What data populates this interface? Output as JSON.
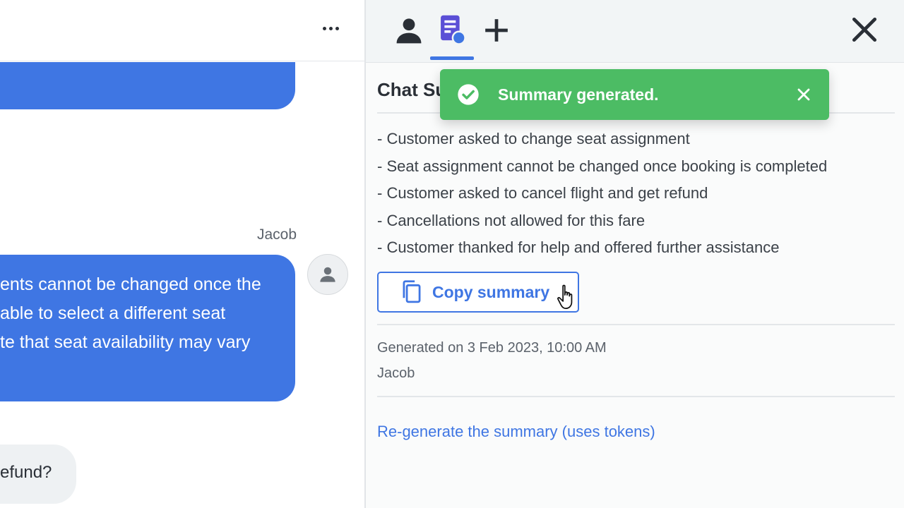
{
  "chat": {
    "sender_name": "Jacob",
    "agent_message_lines": [
      "ents cannot be changed once the",
      "able to select a different seat",
      "te that seat availability may vary"
    ],
    "customer_message": "efund?"
  },
  "panel": {
    "title": "Chat Su",
    "summary_items": [
      "- Customer asked to change seat assignment",
      "- Seat assignment cannot be changed once booking is completed",
      "- Customer asked to cancel flight and get refund",
      "- Cancellations not allowed for this fare",
      "- Customer thanked for help and offered further assistance"
    ],
    "copy_button_label": "Copy summary",
    "generated_on": "Generated on 3 Feb 2023, 10:00 AM",
    "generated_by": "Jacob",
    "regenerate_link": "Re-generate the summary (uses tokens)"
  },
  "toast": {
    "message": "Summary generated."
  },
  "icons": {
    "header": [
      "person-icon",
      "summary-icon",
      "plus-icon",
      "close-icon"
    ],
    "copy": "copy-icon",
    "toast_check": "check-circle-icon",
    "toast_close": "close-icon",
    "more": "more-horizontal-icon",
    "avatar": "user-avatar-icon",
    "cursor": "hand-pointer-icon"
  },
  "colors": {
    "accent": "#3f76e3",
    "toast_bg": "#4cbc64",
    "summary_icon": "#5b4fd6"
  }
}
